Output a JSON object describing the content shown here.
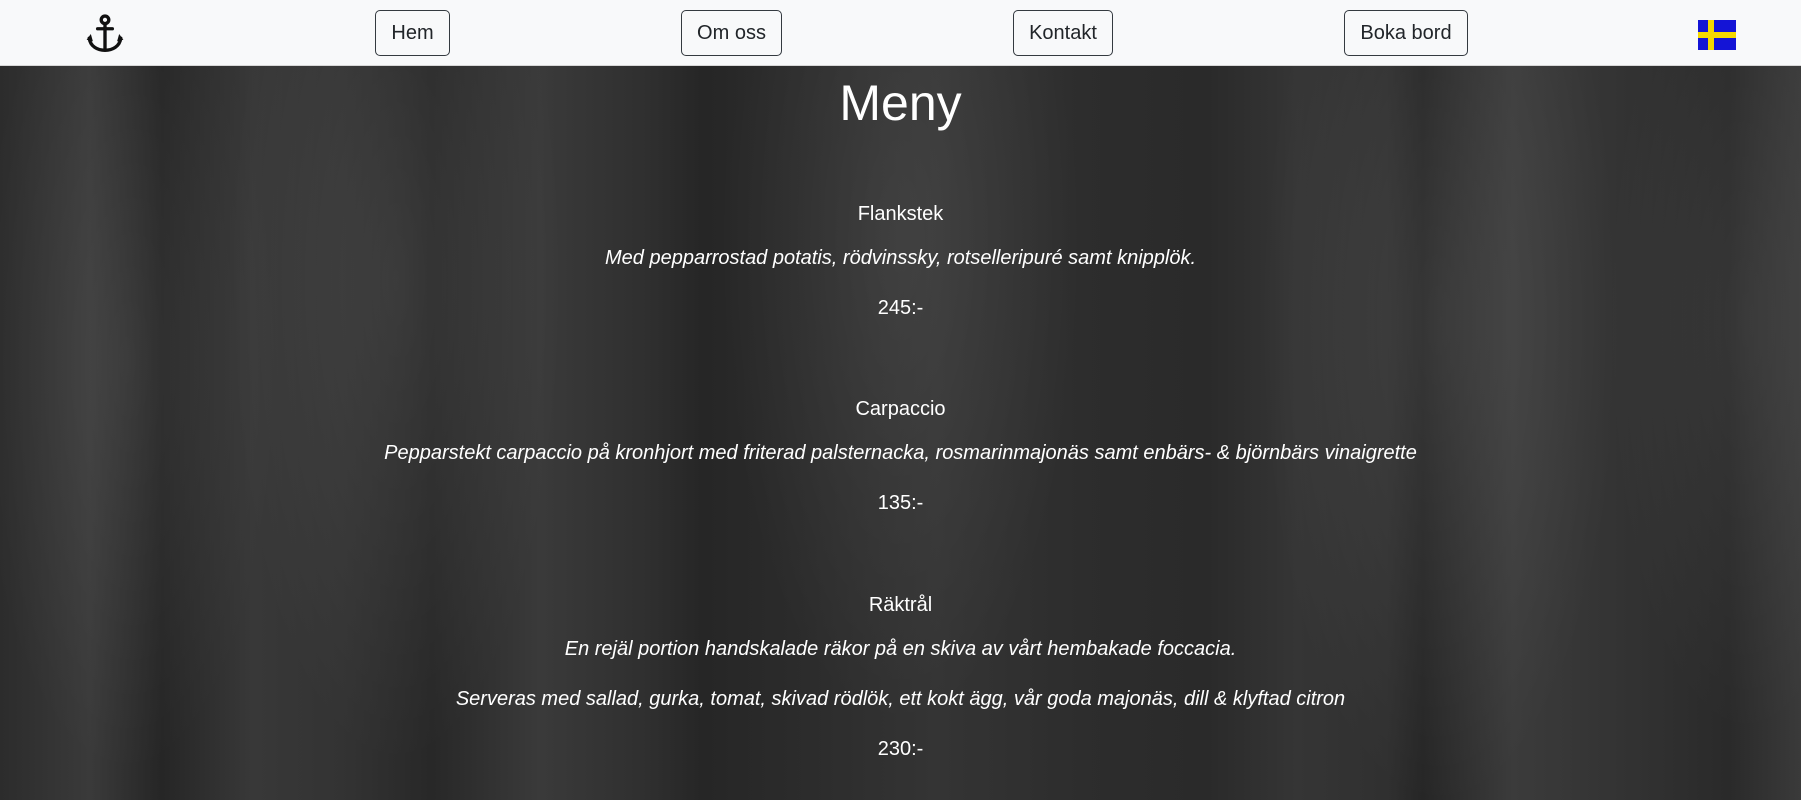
{
  "header": {
    "logo_icon": "anchor-icon",
    "nav": [
      {
        "label": "Hem"
      },
      {
        "label": "Om oss"
      },
      {
        "label": "Kontakt"
      },
      {
        "label": "Boka bord"
      }
    ],
    "language_icon": "swedish-flag-icon"
  },
  "menu": {
    "title": "Meny",
    "dishes": [
      {
        "name": "Flankstek",
        "description": "Med pepparrostad potatis, rödvinssky, rotselleripuré samt knipplök.",
        "price": "245:-"
      },
      {
        "name": "Carpaccio",
        "description": "Pepparstekt carpaccio på kronhjort med friterad palsternacka, rosmarinmajonäs samt enbärs- & björnbärs vinaigrette",
        "price": "135:-"
      },
      {
        "name": "Räktrål",
        "description": "En rejäl portion handskalade räkor på en skiva av vårt hembakade foccacia.",
        "description_2": "Serveras med sallad, gurka, tomat, skivad rödlök, ett kokt ägg, vår goda majonäs, dill & klyftad citron",
        "price": "230:-"
      }
    ]
  },
  "colors": {
    "header_bg": "#f8f9fa",
    "button_border": "#343a40",
    "text_light": "#ffffff",
    "background": "#2e2e2e",
    "flag_blue": "#1414d6",
    "flag_yellow": "#f5d800"
  }
}
